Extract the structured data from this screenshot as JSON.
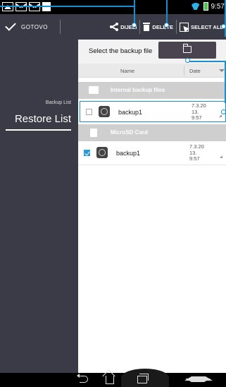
{
  "status_bar": {
    "time": "9:57",
    "icons": [
      "picture-icon",
      "mail-icon",
      "mail-icon",
      "sd-card-icon",
      "wifi-icon",
      "battery-icon"
    ]
  },
  "action_bar": {
    "done_label": "GOTOVO",
    "share_label": "DIJELI",
    "delete_label": "DELETE",
    "select_all_label": "SELECT ALL"
  },
  "sidebar": {
    "subtitle": "Backup List",
    "title": "Restore List"
  },
  "main": {
    "select_label": "Select the backup file",
    "columns": {
      "name": "Name",
      "date": "Date"
    },
    "groups": [
      {
        "label": "Internal backup files",
        "files": [
          {
            "name": "backup1",
            "date": "7.3.20\n13.\n9:57",
            "checked": false
          }
        ]
      },
      {
        "label": "MicroSD Card",
        "files": [
          {
            "name": "backup1",
            "date": "7.3.20\n13.\n9:57",
            "checked": true
          }
        ]
      }
    ]
  },
  "colors": {
    "accent": "#1a8fd0",
    "sidebar_bg": "#3b3b47",
    "action_bar_bg": "#3a3a46"
  }
}
